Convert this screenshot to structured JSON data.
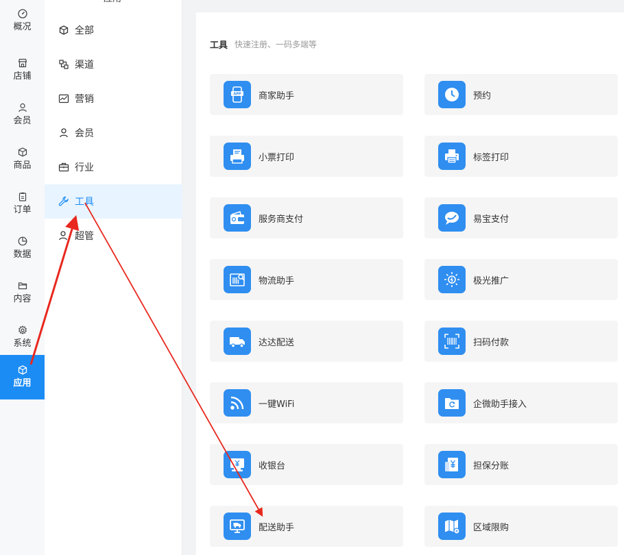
{
  "rail": {
    "items": [
      {
        "label": "概况",
        "icon": "dashboard-icon"
      },
      {
        "label": "店铺",
        "icon": "store-icon"
      },
      {
        "label": "会员",
        "icon": "user-icon"
      },
      {
        "label": "商品",
        "icon": "box-icon"
      },
      {
        "label": "订单",
        "icon": "clipboard-icon"
      },
      {
        "label": "数据",
        "icon": "pie-chart-icon"
      },
      {
        "label": "内容",
        "icon": "folder-icon"
      },
      {
        "label": "系统",
        "icon": "gear-icon"
      },
      {
        "label": "应用",
        "icon": "cube-icon",
        "active": true
      }
    ]
  },
  "submenu": {
    "heading": "应用",
    "items": [
      {
        "label": "全部",
        "icon": "cube-icon"
      },
      {
        "label": "渠道",
        "icon": "channel-icon"
      },
      {
        "label": "营销",
        "icon": "chart-line-icon"
      },
      {
        "label": "会员",
        "icon": "user-icon"
      },
      {
        "label": "行业",
        "icon": "briefcase-icon"
      },
      {
        "label": "工具",
        "icon": "wrench-icon",
        "active": true
      },
      {
        "label": "超管",
        "icon": "admin-icon"
      }
    ]
  },
  "main": {
    "section_title": "工具",
    "section_subtitle": "快速注册、一码多端等",
    "cards": [
      {
        "label": "商家助手",
        "icon": "app-phone-icon"
      },
      {
        "label": "预约",
        "icon": "clock-icon"
      },
      {
        "label": "小票打印",
        "icon": "receipt-printer-icon"
      },
      {
        "label": "标签打印",
        "icon": "printer-icon"
      },
      {
        "label": "服务商支付",
        "icon": "wallet-icon"
      },
      {
        "label": "易宝支付",
        "icon": "chat-bubble-icon"
      },
      {
        "label": "物流助手",
        "icon": "barcode-search-icon"
      },
      {
        "label": "极光推广",
        "icon": "sun-icon"
      },
      {
        "label": "达达配送",
        "icon": "truck-icon"
      },
      {
        "label": "扫码付款",
        "icon": "scan-barcode-icon"
      },
      {
        "label": "一键WiFi",
        "icon": "wifi-icon"
      },
      {
        "label": "企微助手接入",
        "icon": "folder-sync-icon"
      },
      {
        "label": "收银台",
        "icon": "cashier-icon"
      },
      {
        "label": "担保分账",
        "icon": "yuan-document-icon"
      },
      {
        "label": "配送助手",
        "icon": "monitor-truck-icon"
      },
      {
        "label": "区域限购",
        "icon": "map-icon"
      }
    ]
  },
  "colors": {
    "accent": "#1c8cf5",
    "app_icon_bg": "#2f8ef0",
    "annotation": "#e8281e"
  }
}
